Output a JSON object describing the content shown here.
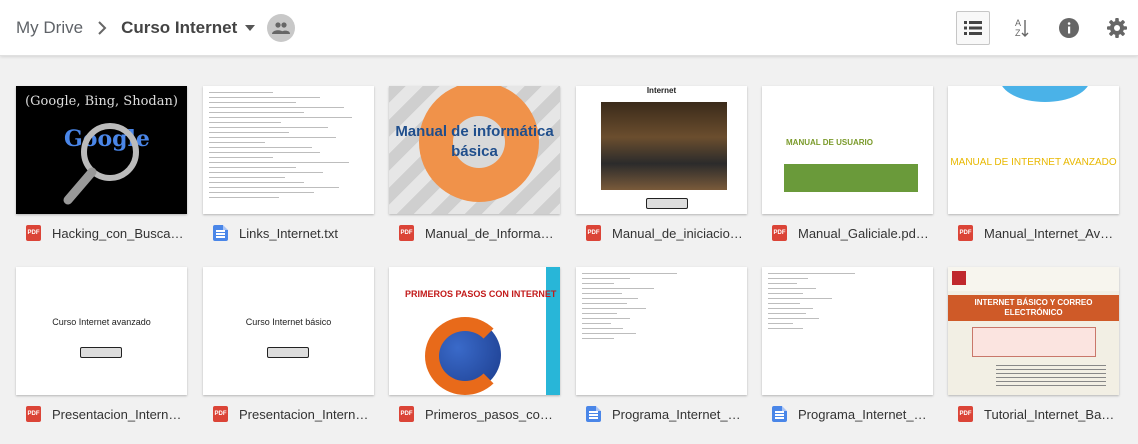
{
  "breadcrumb": {
    "root": "My Drive",
    "current": "Curso Internet"
  },
  "icons": {
    "chevron": "chevron-right-icon",
    "caret": "caret-down-icon",
    "shared": "people-icon",
    "list_view": "list-view-icon",
    "sort": "sort-az-icon",
    "info": "info-icon",
    "settings": "gear-icon"
  },
  "toolbar": {
    "sort_label": "A Z"
  },
  "files": [
    {
      "name": "Hacking_con_Busca…",
      "type": "pdf",
      "badge": "PDF",
      "thumb_text": "(Google, Bing, Shodan)",
      "thumb_logo": "Google"
    },
    {
      "name": "Links_Internet.txt",
      "type": "doc"
    },
    {
      "name": "Manual_de_Informa…",
      "type": "pdf",
      "badge": "PDF",
      "thumb_text": "Manual de informática básica"
    },
    {
      "name": "Manual_de_iniciacio…",
      "type": "pdf",
      "badge": "PDF",
      "thumb_text": "Internet"
    },
    {
      "name": "Manual_Galiciale.pd…",
      "type": "pdf",
      "badge": "PDF",
      "thumb_text": "MANUAL DE USUARIO"
    },
    {
      "name": "Manual_Internet_Av…",
      "type": "pdf",
      "badge": "PDF",
      "thumb_text": "MANUAL DE INTERNET AVANZADO"
    },
    {
      "name": "Presentacion_Intern…",
      "type": "pdf",
      "badge": "PDF",
      "thumb_text": "Curso Internet avanzado"
    },
    {
      "name": "Presentacion_Intern…",
      "type": "pdf",
      "badge": "PDF",
      "thumb_text": "Curso Internet básico"
    },
    {
      "name": "Primeros_pasos_co…",
      "type": "pdf",
      "badge": "PDF",
      "thumb_text": "PRIMEROS PASOS CON INTERNET"
    },
    {
      "name": "Programa_Internet_…",
      "type": "doc"
    },
    {
      "name": "Programa_Internet_…",
      "type": "doc"
    },
    {
      "name": "Tutorial_Internet_Ba…",
      "type": "pdf",
      "badge": "PDF",
      "thumb_text": "INTERNET BÁSICO Y CORREO ELECTRÓNICO"
    }
  ]
}
